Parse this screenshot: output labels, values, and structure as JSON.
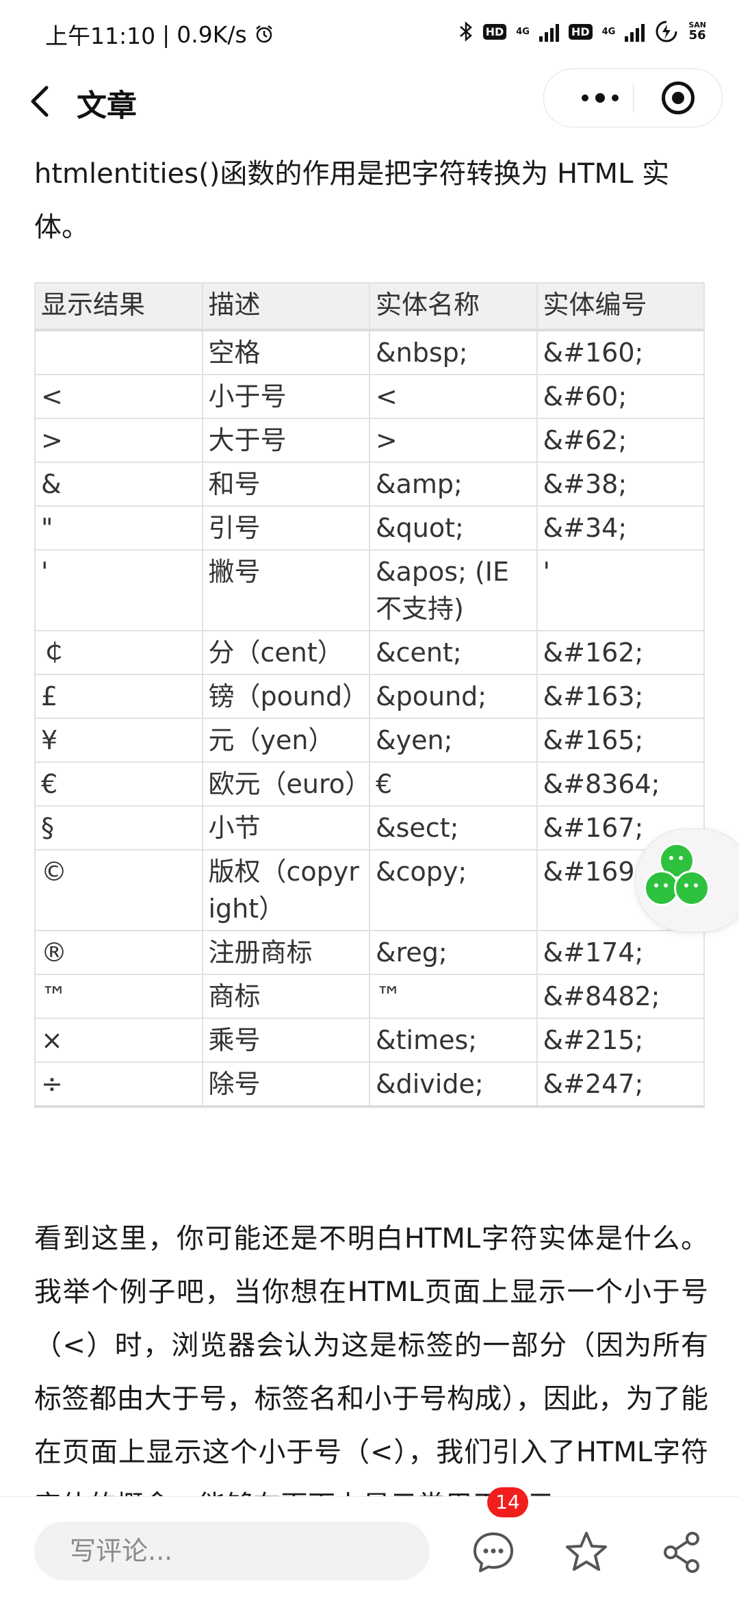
{
  "status_bar": {
    "time": "上午11:10",
    "speed": "0.9K/s",
    "alarm_icon": "alarm-icon",
    "bluetooth_icon": "bluetooth-icon",
    "hd1": "HD",
    "net1": "4G",
    "hd2": "HD",
    "net2": "4G",
    "battery_label": "SAN",
    "battery_level": "56"
  },
  "nav": {
    "back_icon": "chevron-left-icon",
    "title": "文章",
    "more_icon": "more-dots-icon",
    "target_icon": "target-icon"
  },
  "article": {
    "intro": "htmlentities()函数的作用是把字符转换为 HTML 实体。",
    "table": {
      "headers": [
        "显示结果",
        "描述",
        "实体名称",
        "实体编号"
      ],
      "rows": [
        {
          "result": "",
          "desc": "空格",
          "name": "&nbsp;",
          "number": "&#160;"
        },
        {
          "result": "<",
          "desc": "小于号",
          "name": "<",
          "number": "&#60;"
        },
        {
          "result": ">",
          "desc": "大于号",
          "name": ">",
          "number": "&#62;"
        },
        {
          "result": "&",
          "desc": "和号",
          "name": "&amp;",
          "number": "&#38;"
        },
        {
          "result": "\"",
          "desc": "引号",
          "name": "&quot;",
          "number": "&#34;"
        },
        {
          "result": "'",
          "desc": "撇号",
          "name": "&apos; (IE不支持)",
          "number": "'"
        },
        {
          "result": "￠",
          "desc": "分（cent）",
          "name": "&cent;",
          "number": "&#162;"
        },
        {
          "result": "£",
          "desc": "镑（pound）",
          "name": "&pound;",
          "number": "&#163;"
        },
        {
          "result": "¥",
          "desc": "元（yen）",
          "name": "&yen;",
          "number": "&#165;"
        },
        {
          "result": "€",
          "desc": "欧元（euro）",
          "name": "€",
          "number": "&#8364;"
        },
        {
          "result": "§",
          "desc": "小节",
          "name": "&sect;",
          "number": "&#167;"
        },
        {
          "result": "©",
          "desc": "版权（copyright）",
          "name": "&copy;",
          "number": "&#169;"
        },
        {
          "result": "®",
          "desc": "注册商标",
          "name": "&reg;",
          "number": "&#174;"
        },
        {
          "result": "™",
          "desc": "商标",
          "name": "™",
          "number": "&#8482;"
        },
        {
          "result": "×",
          "desc": "乘号",
          "name": "&times;",
          "number": "&#215;"
        },
        {
          "result": "÷",
          "desc": "除号",
          "name": "&divide;",
          "number": "&#247;"
        }
      ]
    },
    "paragraph": "看到这里，你可能还是不明白HTML字符实体是什么。我举个例子吧，当你想在HTML页面上显示一个小于号（<）时，浏览器会认为这是标签的一部分（因为所有标签都由大于号，标签名和小于号构成），因此，为了能在页面上显示这个小于号（<），我们引入了HTML字符实体的概念，能够在页面上显示常用于表示"
  },
  "floating": {
    "icon": "wechat-group-icon"
  },
  "bottom_bar": {
    "comment_placeholder": "写评论...",
    "comment_icon": "comment-icon",
    "comment_count": "14",
    "star_icon": "star-icon",
    "share_icon": "share-icon"
  },
  "colors": {
    "accent_green": "#2dc13e",
    "badge_red": "#f21d1d",
    "table_header_bg": "#f0f0f0"
  }
}
